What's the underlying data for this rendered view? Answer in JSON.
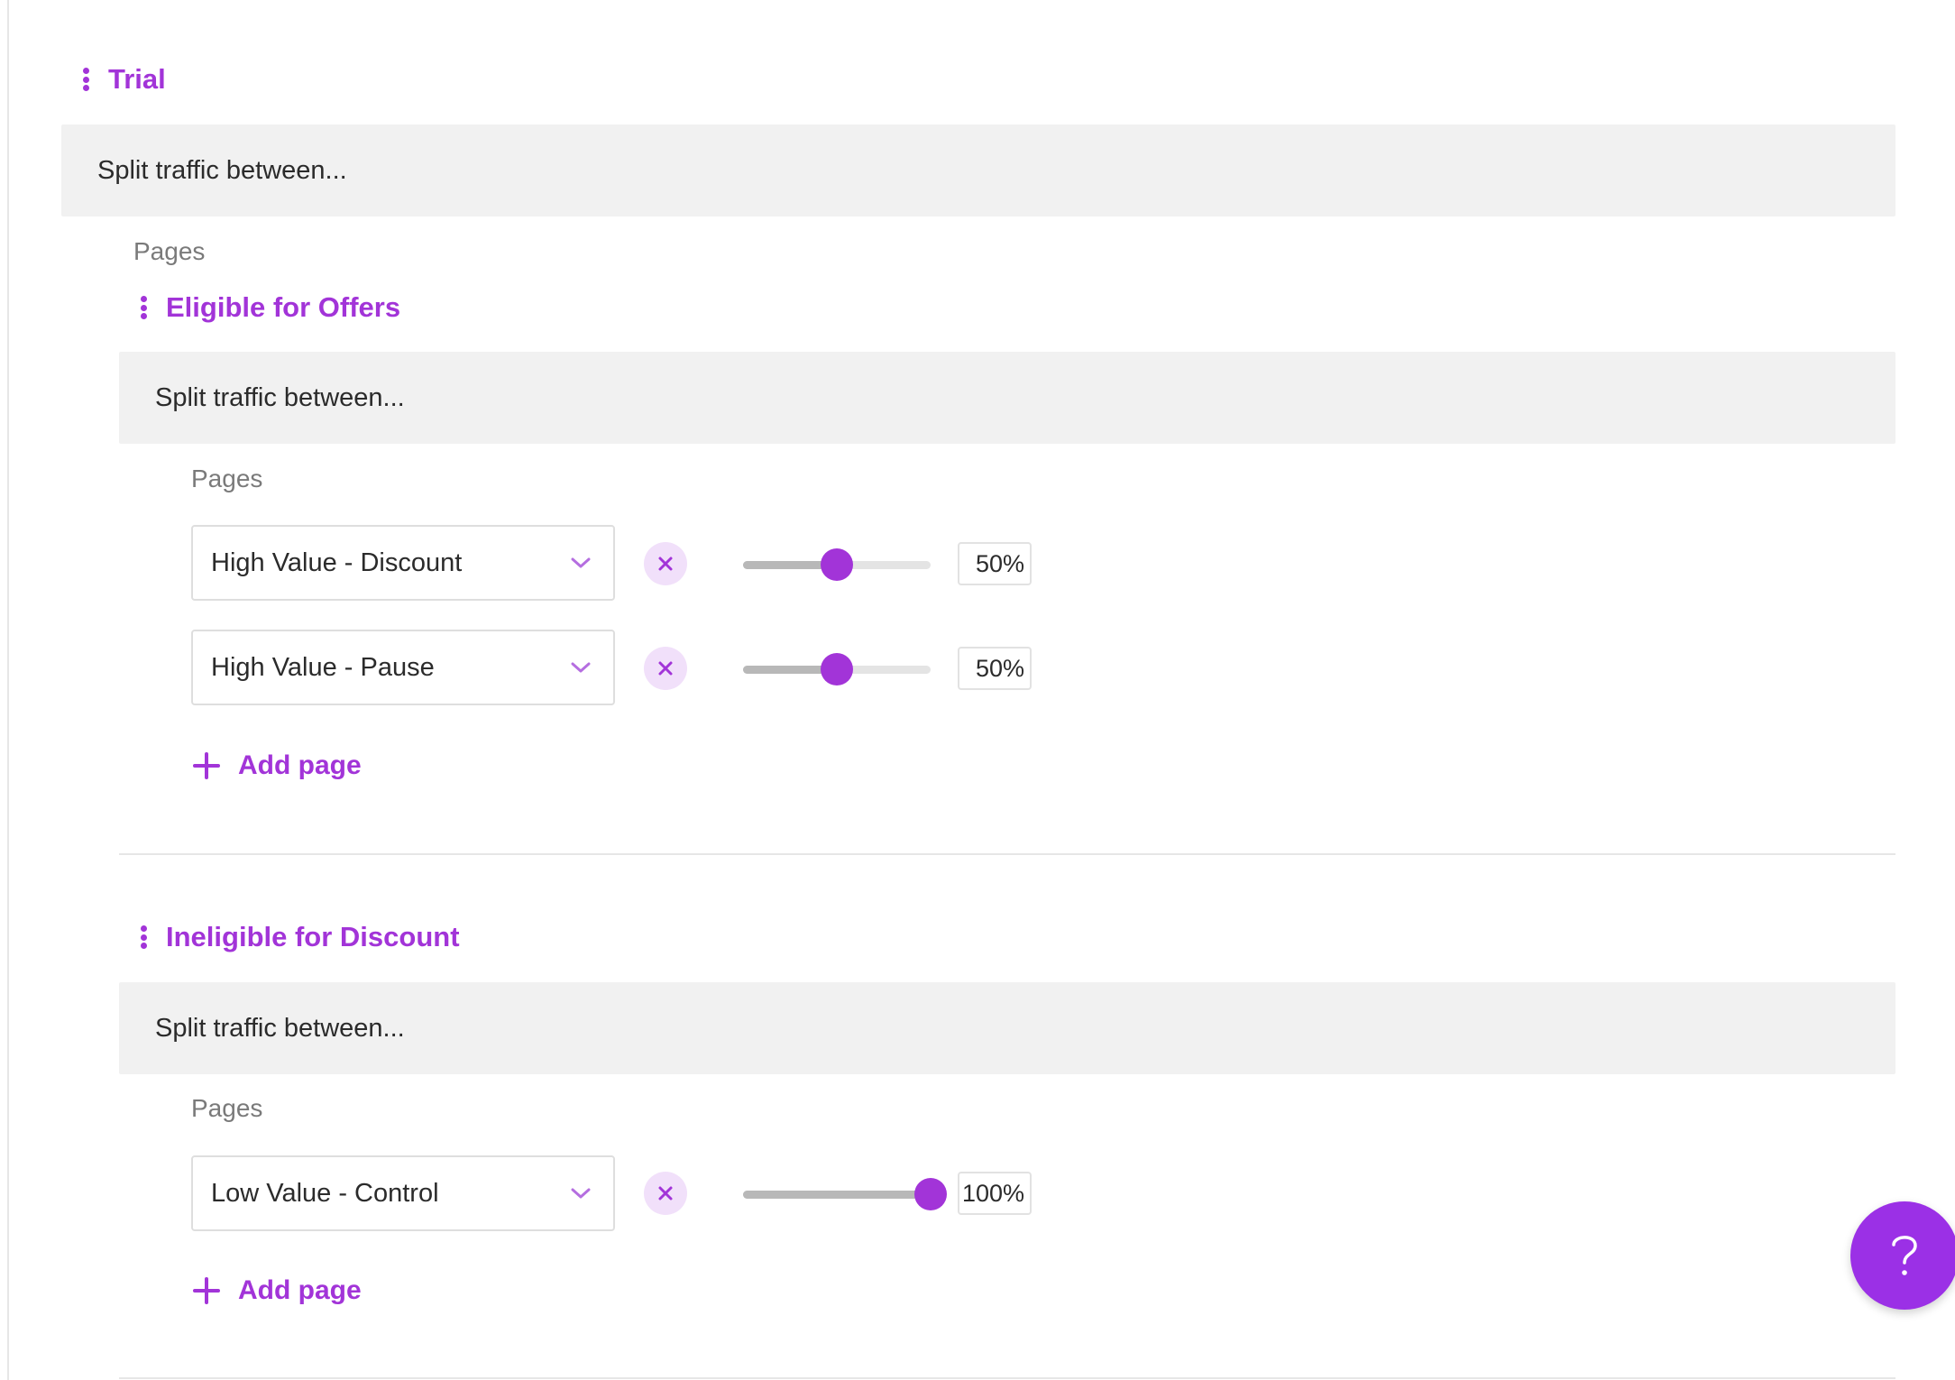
{
  "trial": {
    "title": "Trial",
    "split_label": "Split traffic between...",
    "pages_label": "Pages"
  },
  "eligible": {
    "title": "Eligible for Offers",
    "split_label": "Split traffic between...",
    "pages_label": "Pages",
    "rows": [
      {
        "page": "High Value - Discount",
        "percent_text": "50%",
        "percent_value": 50
      },
      {
        "page": "High Value - Pause",
        "percent_text": "50%",
        "percent_value": 50
      }
    ],
    "add_label": "Add page"
  },
  "ineligible": {
    "title": "Ineligible for Discount",
    "split_label": "Split traffic between...",
    "pages_label": "Pages",
    "rows": [
      {
        "page": "Low Value - Control",
        "percent_text": "100%",
        "percent_value": 100
      }
    ],
    "add_label": "Add page"
  },
  "help": {
    "glyph": "?"
  },
  "colors": {
    "accent": "#a234d8",
    "bar_bg": "#f1f1f1",
    "fab": "#9b30e6"
  },
  "icons": {
    "menu": "kebab-icon",
    "remove": "close-icon",
    "select": "chevron-down-icon",
    "add": "plus-icon",
    "help": "question-icon"
  }
}
